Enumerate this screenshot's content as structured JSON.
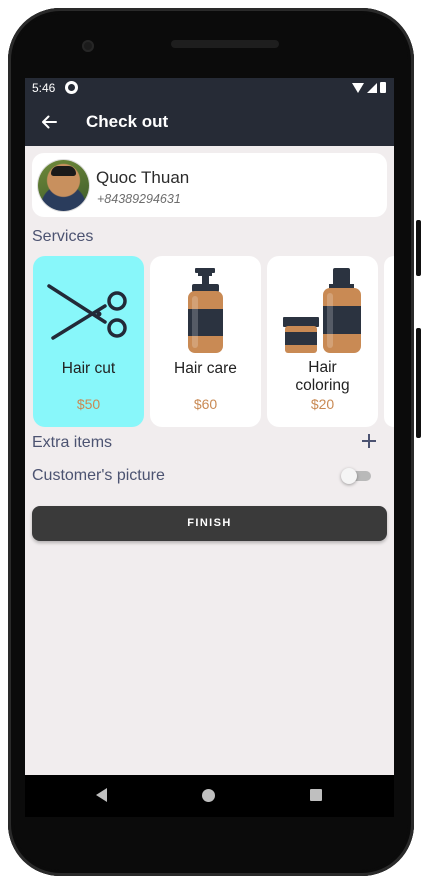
{
  "status_bar": {
    "time": "5:46"
  },
  "appbar": {
    "title": "Check out",
    "back_icon": "arrow-left-icon"
  },
  "customer": {
    "name": "Quoc Thuan",
    "phone": "+84389294631"
  },
  "services": {
    "label": "Services",
    "items": [
      {
        "name": "Hair cut",
        "price": "$50",
        "icon": "scissors-icon",
        "selected": true
      },
      {
        "name": "Hair care",
        "price": "$60",
        "icon": "pump-bottle-icon",
        "selected": false
      },
      {
        "name": "Hair\ncoloring",
        "price": "$20",
        "icon": "color-bottles-icon",
        "selected": false
      }
    ]
  },
  "extra_items": {
    "label": "Extra items",
    "icon": "plus-icon"
  },
  "customer_picture": {
    "label": "Customer's picture",
    "enabled": false
  },
  "finish_button": {
    "label": "FINISH"
  },
  "colors": {
    "appbar": "#262b36",
    "background": "#f1edee",
    "selected_card": "#88f7fa",
    "price": "#c98a54",
    "label": "#4c5371",
    "button": "#3a3a3a"
  }
}
